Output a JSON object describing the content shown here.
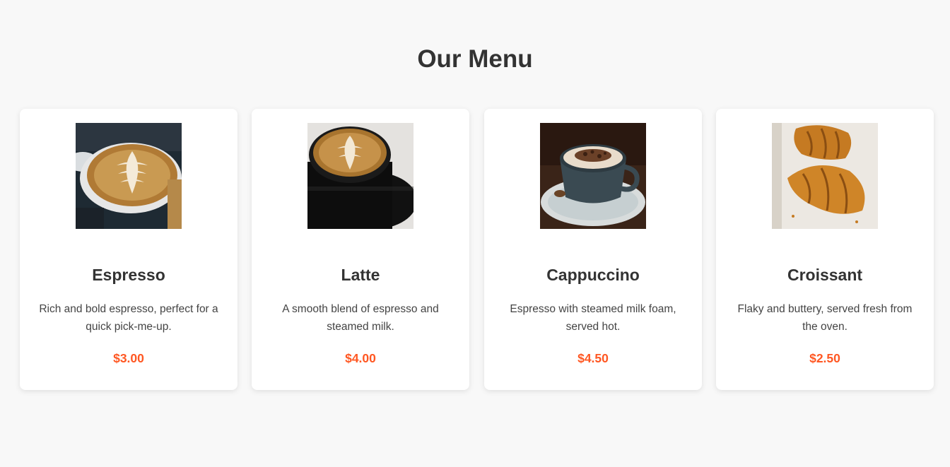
{
  "section": {
    "title": "Our Menu"
  },
  "colors": {
    "background": "#f8f8f8",
    "card": "#ffffff",
    "text": "#333333",
    "price": "#ff5722"
  },
  "items": [
    {
      "name": "Espresso",
      "description": "Rich and bold espresso, perfect for a quick pick-me-up.",
      "price": "$3.00",
      "image": "latte-art-cup-photo"
    },
    {
      "name": "Latte",
      "description": "A smooth blend of espresso and steamed milk.",
      "price": "$4.00",
      "image": "latte-black-cup-photo"
    },
    {
      "name": "Cappuccino",
      "description": "Espresso with steamed milk foam, served hot.",
      "price": "$4.50",
      "image": "cappuccino-cup-photo"
    },
    {
      "name": "Croissant",
      "description": "Flaky and buttery, served fresh from the oven.",
      "price": "$2.50",
      "image": "croissant-photo"
    }
  ]
}
